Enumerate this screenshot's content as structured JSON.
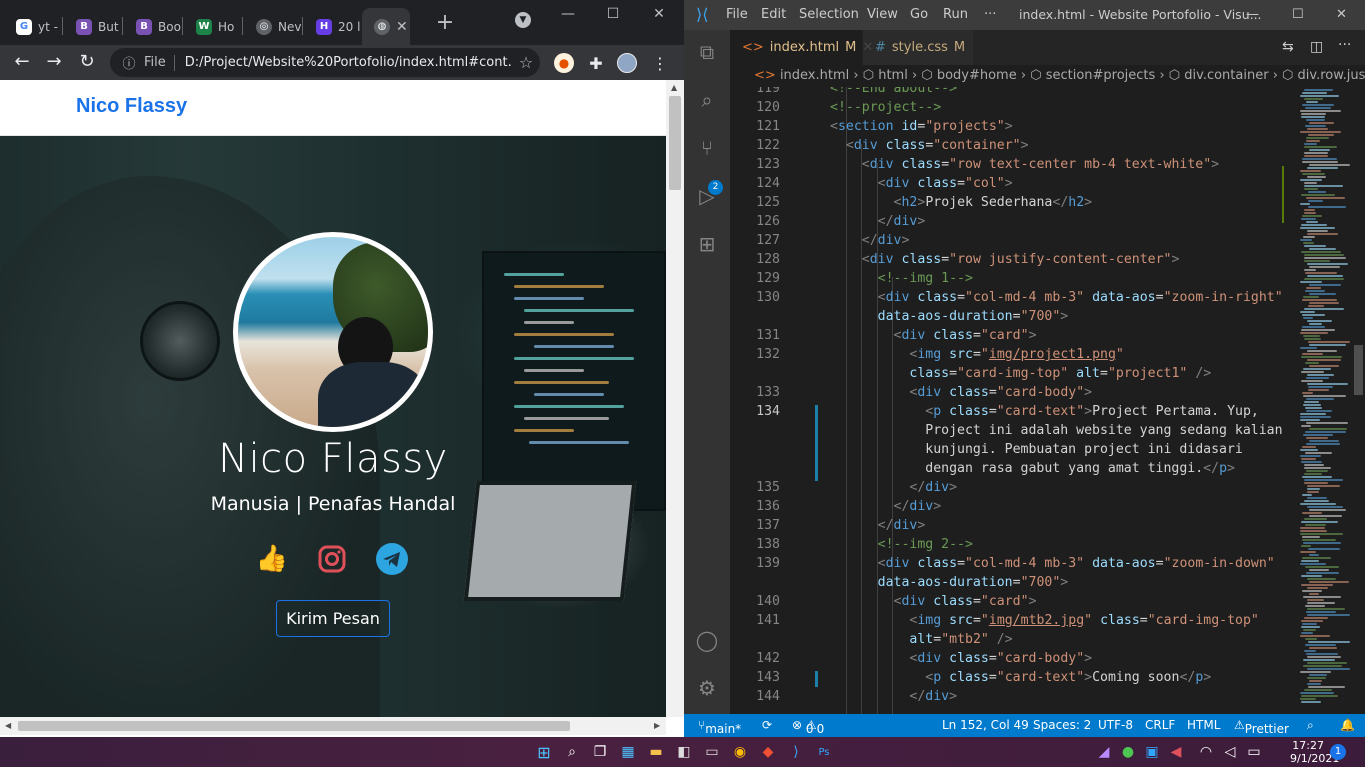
{
  "colors": {
    "brand": "#1a73e8",
    "vscode_status": "#007acc",
    "chrome_dark": "#202124"
  },
  "chrome": {
    "tabs": [
      {
        "icon": "google-icon",
        "label": "yt -"
      },
      {
        "icon": "bootstrap-icon",
        "label": "But"
      },
      {
        "icon": "bootstrap-icon",
        "label": "Boo"
      },
      {
        "icon": "webflow-icon",
        "label": "Ho"
      },
      {
        "icon": "chrome-icon",
        "label": "Nev"
      },
      {
        "icon": "hostinger-icon",
        "label": "20 l"
      },
      {
        "icon": "globe-icon",
        "label": "",
        "active": true
      }
    ],
    "omnibox": {
      "scheme_label": "File",
      "url": "D:/Project/Website%20Portofolio/index.html#cont..."
    }
  },
  "page": {
    "brand": "Nico Flassy",
    "hero": {
      "name": "Nico Flassy",
      "tagline": "Manusia | Penafas Handal",
      "button": "Kirim Pesan"
    },
    "social": [
      "thumbs-up-icon",
      "instagram-icon",
      "telegram-icon"
    ]
  },
  "vscode": {
    "menu": [
      "File",
      "Edit",
      "Selection",
      "View",
      "Go",
      "Run",
      "···"
    ],
    "title": "index.html - Website Portofolio - Visu...",
    "tabs": [
      {
        "label": "index.html",
        "status": "M"
      },
      {
        "label": "style.css",
        "status": "M"
      }
    ],
    "breadcrumb": [
      "index.html",
      "html",
      "body#home",
      "section#projects",
      "div.container",
      "div.row.justify-co"
    ],
    "status": {
      "branch": "main*",
      "errors": "0",
      "warnings": "0",
      "position": "Ln 152, Col 49",
      "spaces": "Spaces: 2",
      "encoding": "UTF-8",
      "eol": "CRLF",
      "language": "HTML",
      "formatter": "Prettier"
    },
    "line_numbers": [
      "119",
      "120",
      "121",
      "122",
      "123",
      "124",
      "125",
      "126",
      "127",
      "128",
      "129",
      "130",
      "",
      "131",
      "132",
      "",
      "133",
      "134",
      "",
      "",
      "",
      "135",
      "136",
      "137",
      "138",
      "139",
      "",
      "140",
      "141",
      "",
      "142",
      "143",
      "144"
    ]
  },
  "taskbar": {
    "time": "17:27",
    "date": "9/1/2021",
    "notifications": "1"
  }
}
